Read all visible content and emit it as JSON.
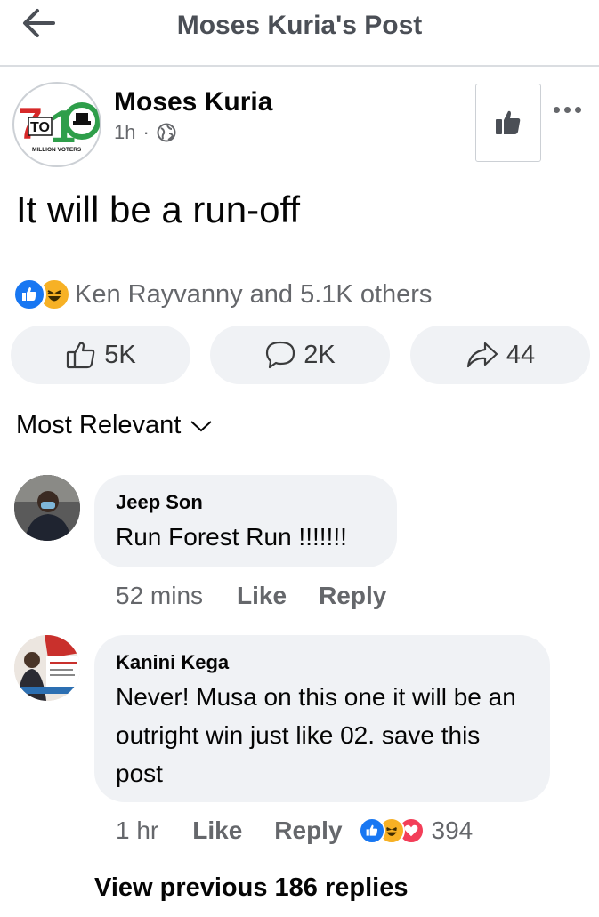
{
  "header": {
    "title": "Moses Kuria's Post",
    "back_icon": "arrow-left-icon"
  },
  "post": {
    "author": "Moses Kuria",
    "avatar_logo": {
      "big": "710",
      "small": "TO",
      "caption": "MILLION VOTERS"
    },
    "time": "1h",
    "separator": "·",
    "privacy_icon": "globe-icon",
    "text": "It will be a run-off",
    "reactions_text": "Ken Rayvanny and 5.1K others",
    "actions": {
      "like_count": "5K",
      "comment_count": "2K",
      "share_count": "44"
    }
  },
  "comments_sort": {
    "label": "Most Relevant"
  },
  "comments": [
    {
      "name": "Jeep Son",
      "text": "Run Forest Run !!!!!!!",
      "time": "52 mins",
      "like": "Like",
      "reply": "Reply"
    },
    {
      "name": "Kanini Kega",
      "text": "Never! Musa on this one it will be an outright win just like 02. save this post",
      "time": "1 hr",
      "like": "Like",
      "reply": "Reply",
      "reaction_count": "394"
    }
  ],
  "view_previous": "View previous 186 replies",
  "colors": {
    "facebook_blue": "#1877f2",
    "haha_yellow": "#f7b125",
    "love_red": "#f33e58",
    "logo_red": "#d62828",
    "logo_green": "#2e9e4a"
  }
}
